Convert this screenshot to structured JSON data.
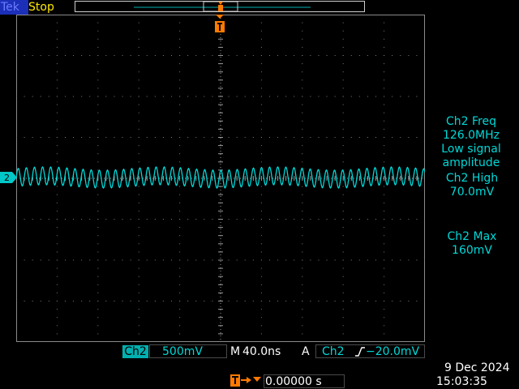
{
  "header": {
    "brand": "Tek",
    "run_state": "Stop"
  },
  "channel": {
    "marker": "2",
    "tag": "Ch2",
    "volts_per_div": "500mV"
  },
  "horizontal": {
    "mode": "M",
    "time_per_div": "40.0ns"
  },
  "trigger": {
    "mode": "A",
    "source": "Ch2",
    "level": "−20.0mV",
    "position": "0.00000 s"
  },
  "measurements": {
    "freq_label": "Ch2 Freq",
    "freq_value": "126.0MHz",
    "freq_note_1": "Low signal",
    "freq_note_2": "amplitude",
    "high_label": "Ch2 High",
    "high_value": "70.0mV",
    "max_label": "Ch2 Max",
    "max_value": "160mV"
  },
  "clock": {
    "date": "9 Dec  2024",
    "time": "15:03:35"
  },
  "colors": {
    "ch2": "#00d8d8",
    "trigger": "#ff7a00",
    "status": "#ffea00",
    "grid": "#9a9a9a"
  },
  "icons": {
    "trigger_marker": "trigger-t-icon",
    "slope": "rising-edge-icon",
    "channel_ground": "ch2-ground-marker"
  }
}
